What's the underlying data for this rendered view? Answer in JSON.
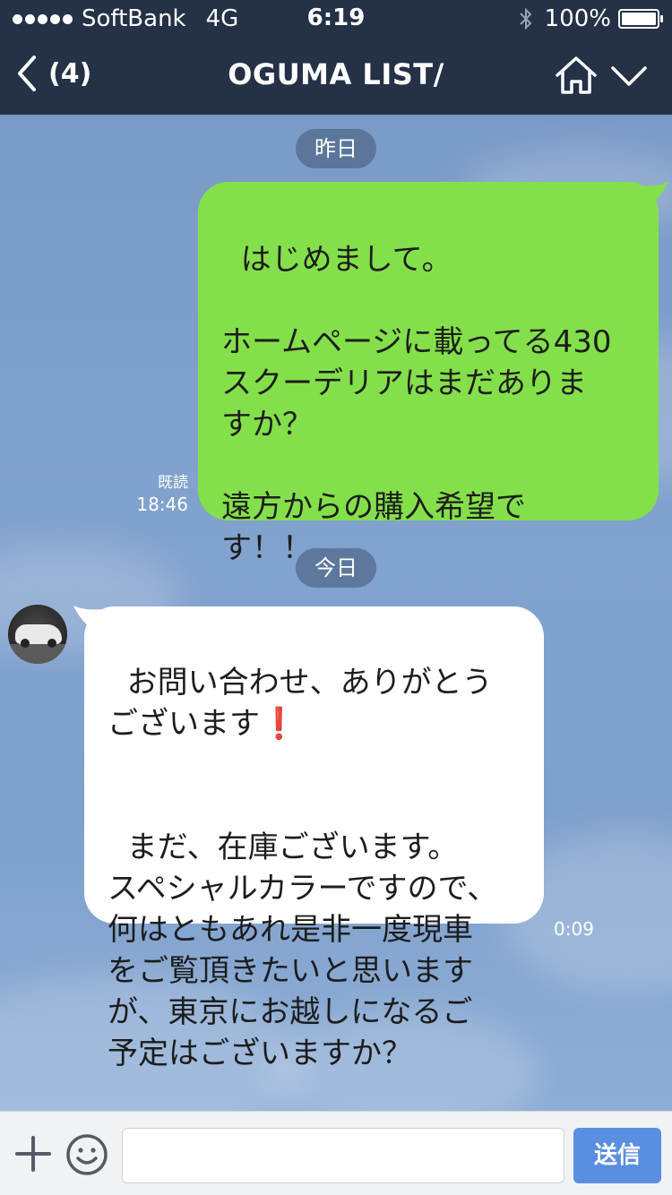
{
  "status_bar": {
    "carrier": "SoftBank",
    "network": "4G",
    "time": "6:19",
    "battery": "100%"
  },
  "header": {
    "back_count": "(4)",
    "title": "OGUMA LIST/"
  },
  "chat": {
    "date_yesterday": "昨日",
    "date_today": "今日",
    "sent_message": {
      "text": "はじめまして。\n\nホームページに載ってる430\nスクーデリアはまだありま\nすか？\n\n遠方からの購入希望で\nす！！",
      "read_label": "既読",
      "time": "18:46"
    },
    "received_message": {
      "text_line1": "お問い合わせ、ありがとう\nございます",
      "text_rest": "まだ、在庫ございます。\nスペシャルカラーですので、\n何はともあれ是非一度現車\nをご覧頂きたいと思います\nが、東京にお越しになるご\n予定はございますか？",
      "time": "0:09"
    }
  },
  "input_bar": {
    "placeholder": "",
    "send_label": "送信"
  },
  "colors": {
    "header_bg": "#243146",
    "sent_bubble": "#84e04a",
    "received_bubble": "#ffffff",
    "send_button": "#5a8ee0"
  },
  "icons": [
    "back-chevron-icon",
    "home-icon",
    "chevron-down-icon",
    "plus-icon",
    "emoji-icon",
    "bluetooth-icon",
    "battery-icon",
    "exclamation-icon"
  ]
}
